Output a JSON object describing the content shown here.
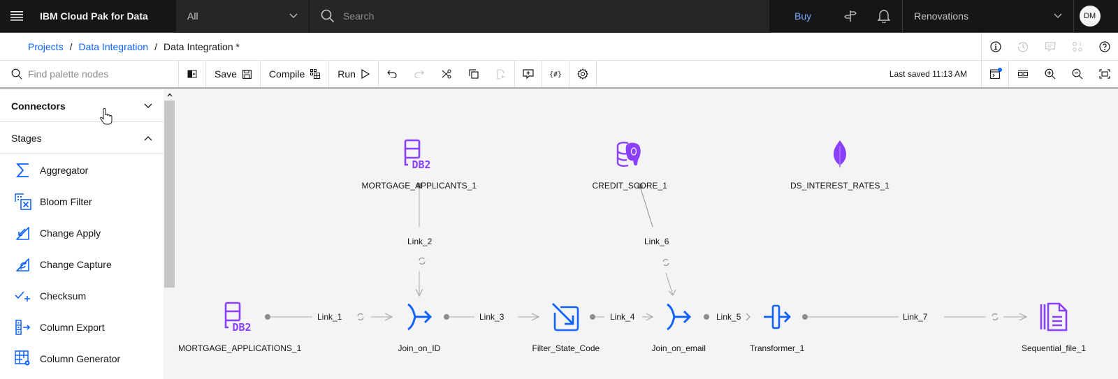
{
  "header": {
    "brand": "IBM Cloud Pak for Data",
    "scope_selected": "All",
    "search_placeholder": "Search",
    "buy_label": "Buy",
    "account_name": "Renovations",
    "avatar_initials": "DM"
  },
  "breadcrumb": {
    "items": [
      "Projects",
      "Data Integration"
    ],
    "current": "Data Integration *"
  },
  "toolbar": {
    "palette_search_placeholder": "Find palette nodes",
    "save_label": "Save",
    "compile_label": "Compile",
    "run_label": "Run",
    "last_saved": "Last saved 11:13 AM"
  },
  "palette": {
    "sections": [
      {
        "label": "Connectors",
        "expanded": false
      },
      {
        "label": "Stages",
        "expanded": true
      }
    ],
    "stages": [
      {
        "label": "Aggregator",
        "icon": "sigma-icon"
      },
      {
        "label": "Bloom Filter",
        "icon": "bloom-filter-icon"
      },
      {
        "label": "Change Apply",
        "icon": "change-apply-icon"
      },
      {
        "label": "Change Capture",
        "icon": "change-capture-icon"
      },
      {
        "label": "Checksum",
        "icon": "checksum-icon"
      },
      {
        "label": "Column Export",
        "icon": "column-export-icon"
      },
      {
        "label": "Column Generator",
        "icon": "column-generator-icon"
      }
    ]
  },
  "canvas": {
    "colors": {
      "connector": "#8a3ffc",
      "stage": "#0f62fe",
      "link": "#a8a8a8",
      "port": "#8d8d8d"
    },
    "nodes": [
      {
        "id": "mortgage_applicants",
        "label": "MORTGAGE_APPLICANTS_1",
        "icon": "db2-icon",
        "type": "connector"
      },
      {
        "id": "credit_score",
        "label": "CREDIT_SCORE_1",
        "icon": "postgresql-icon",
        "type": "connector"
      },
      {
        "id": "ds_interest_rates",
        "label": "DS_INTEREST_RATES_1",
        "icon": "mongodb-leaf-icon",
        "type": "connector"
      },
      {
        "id": "mortgage_applications",
        "label": "MORTGAGE_APPLICATIONS_1",
        "icon": "db2-icon",
        "type": "connector"
      },
      {
        "id": "join_on_id",
        "label": "Join_on_ID",
        "icon": "join-icon",
        "type": "stage"
      },
      {
        "id": "filter_state_code",
        "label": "Filter_State_Code",
        "icon": "filter-icon",
        "type": "stage"
      },
      {
        "id": "join_on_email",
        "label": "Join_on_email",
        "icon": "join-icon",
        "type": "stage"
      },
      {
        "id": "transformer",
        "label": "Transformer_1",
        "icon": "transformer-icon",
        "type": "stage"
      },
      {
        "id": "sequential_file",
        "label": "Sequential_file_1",
        "icon": "sequential-file-icon",
        "type": "connector"
      }
    ],
    "links": [
      {
        "label": "Link_1",
        "from": "mortgage_applications",
        "to": "join_on_id"
      },
      {
        "label": "Link_2",
        "from": "mortgage_applicants",
        "to": "join_on_id"
      },
      {
        "label": "Link_3",
        "from": "join_on_id",
        "to": "filter_state_code"
      },
      {
        "label": "Link_4",
        "from": "filter_state_code",
        "to": "join_on_email"
      },
      {
        "label": "Link_5",
        "from": "join_on_email",
        "to": "transformer"
      },
      {
        "label": "Link_6",
        "from": "credit_score",
        "to": "join_on_email"
      },
      {
        "label": "Link_7",
        "from": "transformer",
        "to": "sequential_file"
      }
    ]
  }
}
